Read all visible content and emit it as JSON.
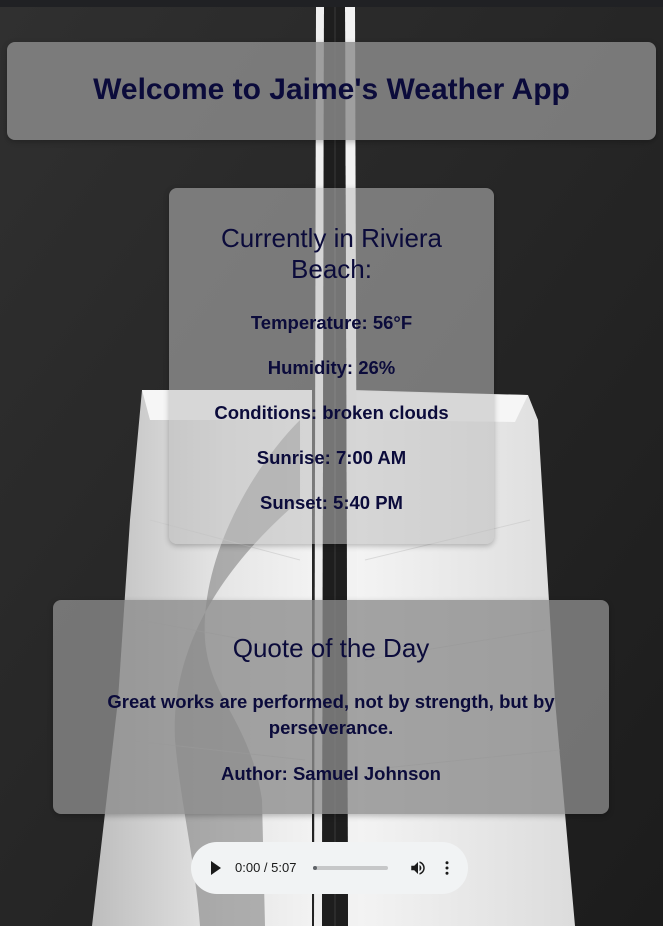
{
  "header": {
    "title": "Welcome to Jaime's Weather App"
  },
  "weather": {
    "title": "Currently in Riviera Beach:",
    "temperature": "Temperature: 56°F",
    "humidity": "Humidity: 26%",
    "conditions": "Conditions: broken clouds",
    "sunrise": "Sunrise: 7:00 AM",
    "sunset": "Sunset: 5:40 PM"
  },
  "quote": {
    "title": "Quote of the Day",
    "text": "Great works are performed, not by strength, but by perseverance.",
    "author": "Author: Samuel Johnson"
  },
  "audio": {
    "time": "0:00 / 5:07",
    "progress_fraction": 0.0,
    "play_icon": "play-icon",
    "volume_icon": "volume-icon",
    "more_icon": "more-vert-icon"
  },
  "colors": {
    "text": "#0b0b3b",
    "background": "#2a2a2a"
  }
}
